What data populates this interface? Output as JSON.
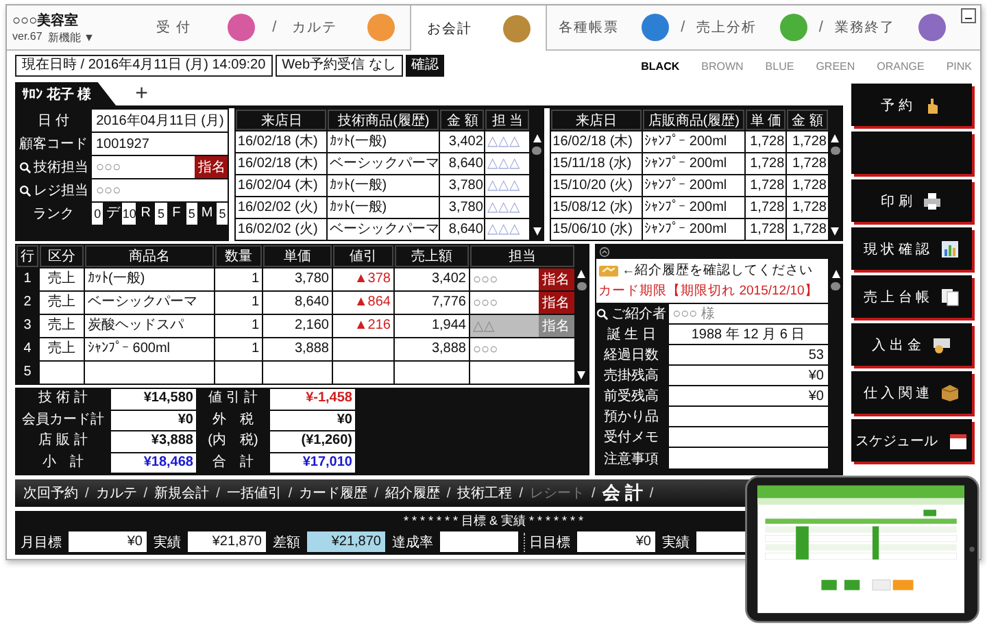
{
  "app": {
    "shop_name": "○○○美容室",
    "version": "ver.67",
    "new_features": "新機能 ▼"
  },
  "tabs": [
    {
      "label": "受 付",
      "selected": false,
      "color": "#d65aa0",
      "divider": "/"
    },
    {
      "label": "カルテ",
      "selected": false,
      "color": "#f0963c"
    },
    {
      "label": "お会計",
      "selected": true,
      "color": "#b98a3a"
    },
    {
      "label": "各種帳票",
      "selected": false,
      "color": "#2d7fd4",
      "divider": "/"
    },
    {
      "label": "売上分析",
      "selected": false,
      "color": "#4caf3c",
      "divider": "/"
    },
    {
      "label": "業務終了",
      "selected": false,
      "color": "#8a6bc0"
    }
  ],
  "toolbar": {
    "datetime": "現在日時 / 2016年4月11日 (月)  14:09:20",
    "web_reservation": "Web予約受信 なし",
    "confirm_button": "確認"
  },
  "themes": [
    {
      "label": "BLACK",
      "selected": true
    },
    {
      "label": "BROWN",
      "selected": false
    },
    {
      "label": "BLUE",
      "selected": false
    },
    {
      "label": "GREEN",
      "selected": false
    },
    {
      "label": "ORANGE",
      "selected": false
    },
    {
      "label": "PINK",
      "selected": false
    }
  ],
  "customer_tab": {
    "name": "ｻﾛﾝ 花子 様",
    "add": "+"
  },
  "info": {
    "rows": [
      {
        "label": "日 付",
        "value": "2016年04月11日 (月)",
        "kind": "text"
      },
      {
        "label": "顧客コード",
        "value": "1001927",
        "kind": "text"
      },
      {
        "label": "技術担当",
        "value": "○○○",
        "kind": "staff",
        "badge": "指名"
      },
      {
        "label": "レジ担当",
        "value": "○○○",
        "kind": "staff"
      }
    ],
    "rank": {
      "label": "ランク",
      "first": "0",
      "pairs": [
        {
          "letter": "デ",
          "value": "10"
        },
        {
          "letter": "R",
          "value": "5"
        },
        {
          "letter": "F",
          "value": "5"
        },
        {
          "letter": "M",
          "value": "5"
        }
      ]
    }
  },
  "tech_history": {
    "columns": [
      "来店日",
      "技術商品(履歴)",
      "金 額",
      "担 当"
    ],
    "rows": [
      [
        "16/02/18 (木)",
        "ｶｯﾄ(一般)",
        "3,402",
        "△△△"
      ],
      [
        "16/02/18 (木)",
        "ベーシックパーマ",
        "8,640",
        "△△△"
      ],
      [
        "16/02/04 (木)",
        "ｶｯﾄ(一般)",
        "3,780",
        "△△△"
      ],
      [
        "16/02/02 (火)",
        "ｶｯﾄ(一般)",
        "3,780",
        "△△△"
      ],
      [
        "16/02/02 (火)",
        "ベーシックパーマ",
        "8,640",
        "△△△"
      ]
    ]
  },
  "retail_history": {
    "columns": [
      "来店日",
      "店販商品(履歴)",
      "単 価",
      "金 額"
    ],
    "rows": [
      [
        "16/02/18 (木)",
        "ｼｬﾝﾌﾟｰ 200ml",
        "1,728",
        "1,728"
      ],
      [
        "15/11/18 (水)",
        "ｼｬﾝﾌﾟｰ 200ml",
        "1,728",
        "1,728"
      ],
      [
        "15/10/20 (火)",
        "ｼｬﾝﾌﾟｰ 200ml",
        "1,728",
        "1,728"
      ],
      [
        "15/08/12 (水)",
        "ｼｬﾝﾌﾟｰ 200ml",
        "1,728",
        "1,728"
      ],
      [
        "15/06/10 (水)",
        "ｼｬﾝﾌﾟｰ 200ml",
        "1,728",
        "1,728"
      ]
    ]
  },
  "items": {
    "columns": [
      "行",
      "区分",
      "商品名",
      "数量",
      "単価",
      "値引",
      "売上額",
      "担当"
    ],
    "rows": [
      {
        "no": "1",
        "type": "売上",
        "name": "ｶｯﾄ(一般)",
        "qty": "1",
        "price": "3,780",
        "discount": "▲378",
        "amount": "3,402",
        "staff": "○○○",
        "badge": "指名",
        "nominated": true,
        "highlighted": false
      },
      {
        "no": "2",
        "type": "売上",
        "name": "ベーシックパーマ",
        "qty": "1",
        "price": "8,640",
        "discount": "▲864",
        "amount": "7,776",
        "staff": "○○○",
        "badge": "指名",
        "nominated": true,
        "highlighted": false
      },
      {
        "no": "3",
        "type": "売上",
        "name": "炭酸ヘッドスパ",
        "qty": "1",
        "price": "2,160",
        "discount": "▲216",
        "amount": "1,944",
        "staff": "△△",
        "badge": "指名",
        "nominated": false,
        "highlighted": true
      },
      {
        "no": "4",
        "type": "売上",
        "name": "ｼｬﾝﾌﾟｰ 600ml",
        "qty": "1",
        "price": "3,888",
        "amount": "3,888",
        "staff": "○○○",
        "highlighted": false
      },
      {
        "no": "5",
        "highlighted": false
      }
    ]
  },
  "side_panel": {
    "notice": "←紹介履歴を確認してください",
    "card_expiry": "カード期限【期限切れ 2015/12/10】",
    "rows": [
      {
        "label": "ご紹介者",
        "value": "○○○  様",
        "kind": "search"
      },
      {
        "label": "誕 生 日",
        "value": "1988 年 12 月  6 日",
        "kind": "center"
      },
      {
        "label": "経過日数",
        "value": "53",
        "kind": "right"
      },
      {
        "label": "売掛残高",
        "value": "¥0",
        "kind": "right"
      },
      {
        "label": "前受残高",
        "value": "¥0",
        "kind": "right"
      },
      {
        "label": "預かり品",
        "kind": "right"
      },
      {
        "label": "受付メモ",
        "kind": "right"
      },
      {
        "label": "注意事項",
        "kind": "tall"
      }
    ]
  },
  "totals": [
    {
      "label": "技 術 計",
      "value": "¥14,580",
      "kind": "normal"
    },
    {
      "label": "値 引 計",
      "value": "¥-1,458",
      "kind": "discount"
    },
    {
      "label": "会員カード計",
      "value": "¥0",
      "kind": "normal"
    },
    {
      "label": "外　税",
      "value": "¥0",
      "kind": "normal"
    },
    {
      "label": "店 販 計",
      "value": "¥3,888",
      "kind": "normal"
    },
    {
      "label": "(内　税)",
      "value": "(¥1,260)",
      "kind": "normal"
    },
    {
      "label": "小　計",
      "value": "¥18,468",
      "kind": "sum"
    },
    {
      "label": "合　計",
      "value": "¥17,010",
      "kind": "sum"
    }
  ],
  "side_buttons": [
    {
      "label": "予 約",
      "kind": "hand"
    },
    {
      "kind": "blank"
    },
    {
      "label": "印 刷",
      "kind": "printer"
    },
    {
      "label": "現 状 確 認",
      "kind": "chart"
    },
    {
      "label": "売 上 台 帳",
      "kind": "pages"
    },
    {
      "label": "入 出 金",
      "kind": "cash"
    },
    {
      "label": "仕 入 関 連",
      "kind": "box"
    },
    {
      "label": "スケジュール",
      "kind": "calendar"
    }
  ],
  "nav": [
    {
      "label": "次回予約",
      "divider": "/",
      "kind": "normal",
      "disabled": false
    },
    {
      "label": "カルテ",
      "divider": "/",
      "kind": "normal",
      "disabled": false
    },
    {
      "label": "新規会計",
      "divider": "/",
      "kind": "normal",
      "disabled": false
    },
    {
      "label": "一括値引",
      "divider": "/",
      "kind": "normal",
      "disabled": false
    },
    {
      "label": "カード履歴",
      "divider": "/",
      "kind": "normal",
      "disabled": false
    },
    {
      "label": "紹介履歴",
      "divider": "/",
      "kind": "normal",
      "disabled": false
    },
    {
      "label": "技術工程",
      "divider": "/",
      "kind": "normal",
      "disabled": false
    },
    {
      "label": "レシート",
      "divider": "/",
      "kind": "normal",
      "disabled": true
    },
    {
      "label": "会 計",
      "divider": "/",
      "kind": "primary",
      "disabled": false
    }
  ],
  "targets": {
    "title": "* * * * * * *  目標 & 実績  * * * * * * *",
    "fields": [
      {
        "label": "月目標",
        "value": "¥0",
        "highlight": false
      },
      {
        "label": "実績",
        "value": "¥21,870",
        "highlight": false
      },
      {
        "label": "差額",
        "value": "¥21,870",
        "highlight": true
      },
      {
        "label": "達成率",
        "highlight": false
      },
      {
        "label": "日目標",
        "value": "¥0",
        "highlight": false,
        "divider_before": true
      },
      {
        "label": "実績",
        "highlight": false
      }
    ]
  }
}
